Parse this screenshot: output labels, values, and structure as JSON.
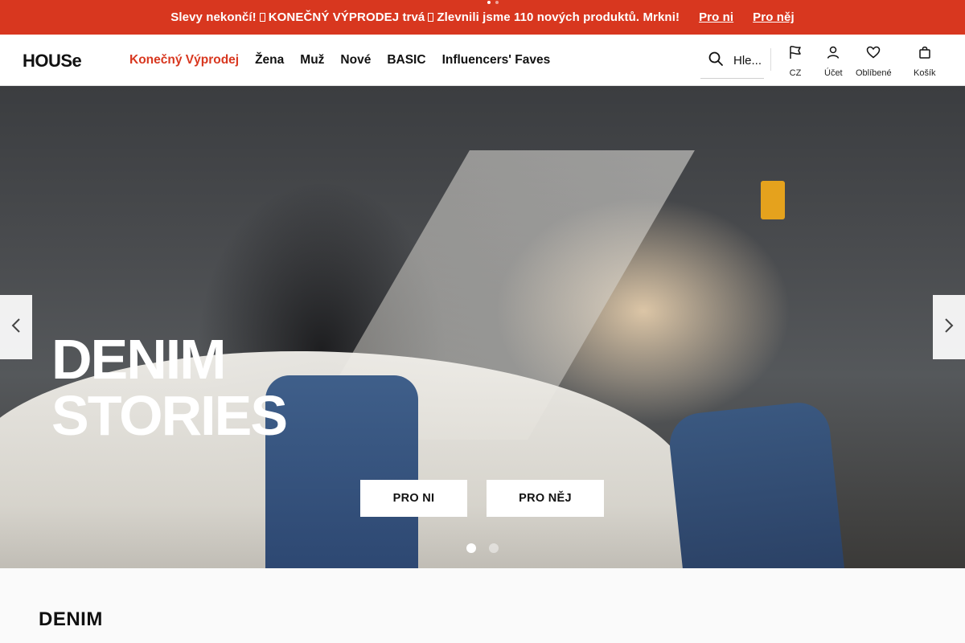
{
  "promo": {
    "text_1": "Slevy nekončí!",
    "text_2": "KONEČNÝ VÝPRODEJ trvá",
    "text_3": "Zlevnili jsme 110 nových produktů. Mrkni!",
    "link_her": "Pro ni",
    "link_him": "Pro něj",
    "background": "#d8371f"
  },
  "header": {
    "logo": "HOUSe",
    "nav": [
      "Konečný Výprodej",
      "Žena",
      "Muž",
      "Nové",
      "BASIC",
      "Influencers' Faves"
    ],
    "search_placeholder": "Hledat",
    "search_display": "Hle...",
    "icons": {
      "country": "CZ",
      "account": "Účet",
      "favorites": "Oblíbené",
      "cart": "Košík"
    },
    "sale_color": "#d8371f"
  },
  "hero": {
    "title_line_1": "DENIM",
    "title_line_2": "STORIES",
    "button_her": "PRO NI",
    "button_him": "PRO NĚJ",
    "slide_count": 2,
    "active_slide": 1
  },
  "section": {
    "title": "DENIM"
  }
}
